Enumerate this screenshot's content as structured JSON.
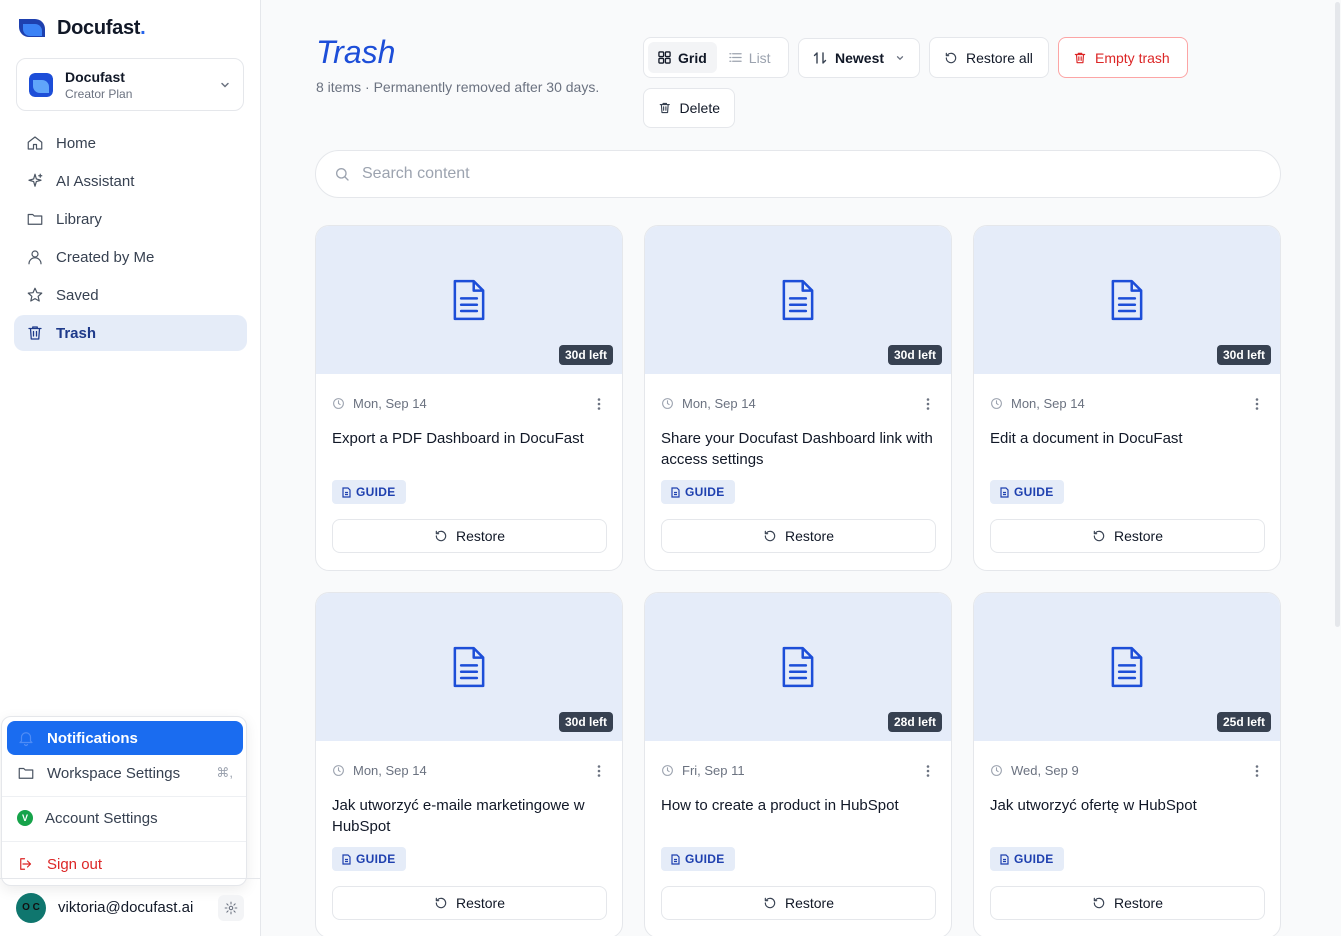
{
  "brand": {
    "name": "Docufast",
    "dot": "."
  },
  "workspace": {
    "name": "Docufast",
    "plan": "Creator Plan"
  },
  "nav": [
    {
      "label": "Home",
      "icon": "home-icon"
    },
    {
      "label": "AI Assistant",
      "icon": "sparkle-icon"
    },
    {
      "label": "Library",
      "icon": "folder-icon"
    },
    {
      "label": "Created by Me",
      "icon": "user-icon"
    },
    {
      "label": "Saved",
      "icon": "star-icon"
    },
    {
      "label": "Trash",
      "icon": "trash-icon",
      "active": true
    }
  ],
  "popup": {
    "notifications": "Notifications",
    "workspace_settings": "Workspace Settings",
    "workspace_shortcut": "⌘,",
    "account_settings": "Account Settings",
    "account_badge": "V",
    "sign_out": "Sign out"
  },
  "user": {
    "email": "viktoria@docufast.ai",
    "initials": "O C"
  },
  "page": {
    "title": "Trash",
    "subtitle": "8 items · Permanently removed after 30 days."
  },
  "toolbar": {
    "grid_label": "Grid",
    "list_label": "List",
    "sort_label": "Newest",
    "restore_all_label": "Restore all",
    "empty_trash_label": "Empty trash",
    "delete_label": "Delete"
  },
  "search": {
    "placeholder": "Search content"
  },
  "colors": {
    "accent": "#1d4ed8",
    "danger": "#dc2626",
    "thumb_bg": "#e5ecf9"
  },
  "cards": [
    {
      "days_left": "30d left",
      "date": "Mon, Sep 14",
      "title": "Export a PDF Dashboard in DocuFast",
      "tag": "GUIDE",
      "restore": "Restore"
    },
    {
      "days_left": "30d left",
      "date": "Mon, Sep 14",
      "title": "Share your Docufast Dashboard link with access settings",
      "tag": "GUIDE",
      "restore": "Restore"
    },
    {
      "days_left": "30d left",
      "date": "Mon, Sep 14",
      "title": "Edit a document in DocuFast",
      "tag": "GUIDE",
      "restore": "Restore"
    },
    {
      "days_left": "30d left",
      "date": "Mon, Sep 14",
      "title": "Jak utworzyć e-maile marketingowe w HubSpot",
      "tag": "GUIDE",
      "restore": "Restore"
    },
    {
      "days_left": "28d left",
      "date": "Fri, Sep 11",
      "title": "How to create a product in HubSpot",
      "tag": "GUIDE",
      "restore": "Restore"
    },
    {
      "days_left": "25d left",
      "date": "Wed, Sep 9",
      "title": "Jak utworzyć ofertę w HubSpot",
      "tag": "GUIDE",
      "restore": "Restore"
    }
  ]
}
